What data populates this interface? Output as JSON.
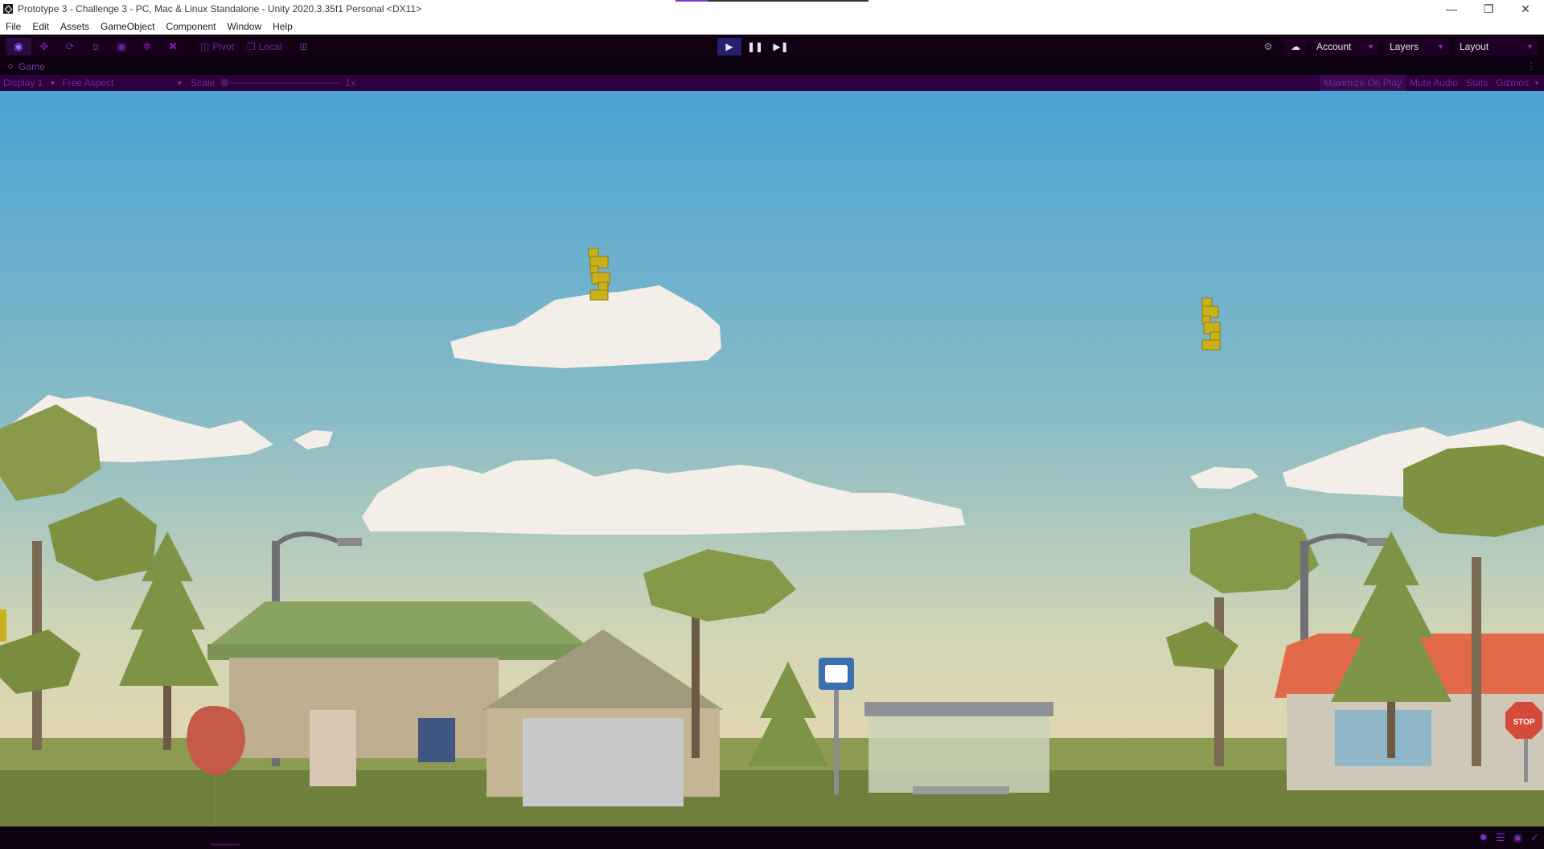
{
  "titlebar": {
    "title": "Prototype 3 - Challenge 3 - PC, Mac & Linux Standalone - Unity 2020.3.35f1 Personal <DX11>",
    "minimize_icon": "minimize-icon",
    "restore_icon": "restore-icon",
    "close_icon": "close-icon"
  },
  "menubar": {
    "items": [
      "File",
      "Edit",
      "Assets",
      "GameObject",
      "Component",
      "Window",
      "Help"
    ]
  },
  "toolbar": {
    "tools": [
      "view-tool-icon",
      "move-tool-icon",
      "rotate-tool-icon",
      "scale-tool-icon",
      "rect-tool-icon",
      "transform-tool-icon",
      "custom-tool-icon"
    ],
    "pivot_label": "Pivot",
    "local_label": "Local",
    "play_state": "playing",
    "account_label": "Account",
    "layers_label": "Layers",
    "layout_label": "Layout"
  },
  "tab": {
    "label": "Game"
  },
  "gamebar": {
    "display_label": "Display 1",
    "aspect_label": "Free Aspect",
    "scale_label": "Scale",
    "scale_value": "1x",
    "maximize_label": "Maximize On Play",
    "mute_label": "Mute Audio",
    "stats_label": "Stats",
    "gizmos_label": "Gizmos"
  },
  "scene": {
    "sign_text": "STOP"
  },
  "colors": {
    "accent": "#7d2fc0",
    "toolbar_bg": "#100012",
    "gamebar_bg": "#2c003c",
    "sky_top": "#4da4d2",
    "sky_bottom": "#e7d6ad"
  }
}
